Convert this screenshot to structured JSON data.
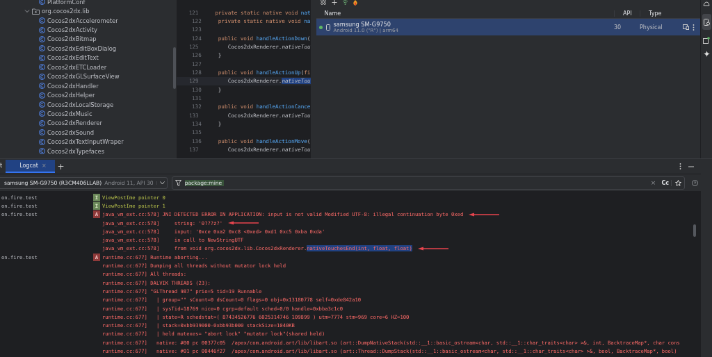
{
  "project_tree": {
    "items": [
      {
        "label": "PlatformConf",
        "kind": "class"
      },
      {
        "label": "org.cocos2dx.lib",
        "kind": "package",
        "expanded": true,
        "children": [
          {
            "label": "Cocos2dxAccelerometer",
            "kind": "class"
          },
          {
            "label": "Cocos2dxActivity",
            "kind": "class"
          },
          {
            "label": "Cocos2dxBitmap",
            "kind": "class"
          },
          {
            "label": "Cocos2dxEditBoxDialog",
            "kind": "class"
          },
          {
            "label": "Cocos2dxEditText",
            "kind": "class"
          },
          {
            "label": "Cocos2dxETCLoader",
            "kind": "class"
          },
          {
            "label": "Cocos2dxGLSurfaceView",
            "kind": "class"
          },
          {
            "label": "Cocos2dxHandler",
            "kind": "class"
          },
          {
            "label": "Cocos2dxHelper",
            "kind": "class"
          },
          {
            "label": "Cocos2dxLocalStorage",
            "kind": "class"
          },
          {
            "label": "Cocos2dxMusic",
            "kind": "class"
          },
          {
            "label": "Cocos2dxRenderer",
            "kind": "class"
          },
          {
            "label": "Cocos2dxSound",
            "kind": "class"
          },
          {
            "label": "Cocos2dxTextInputWraper",
            "kind": "class"
          },
          {
            "label": "Cocos2dxTypefaces",
            "kind": "class"
          }
        ]
      }
    ]
  },
  "editor": {
    "lines": [
      {
        "number": "121",
        "current": false,
        "tokens": [
          {
            "kind": "keyword",
            "text": "private static native void "
          },
          {
            "kind": "method",
            "text": "nat"
          }
        ]
      },
      {
        "number": "122",
        "current": false,
        "tokens": [
          {
            "kind": "keyword",
            "text": "private static native void "
          },
          {
            "kind": "method",
            "text": "na"
          }
        ]
      },
      {
        "number": "123",
        "current": false
      },
      {
        "number": "124",
        "current": false,
        "tokens": [
          {
            "kind": "keyword",
            "text": "public void "
          },
          {
            "kind": "method",
            "text": "handleActionDown"
          },
          {
            "kind": "plain",
            "text": "("
          }
        ]
      },
      {
        "number": "125",
        "current": false,
        "indent": true,
        "tokens": [
          {
            "kind": "plain",
            "text": "Cocos2dxRenderer."
          },
          {
            "kind": "static",
            "text": "nativeTou"
          }
        ]
      },
      {
        "number": "126",
        "current": false,
        "tokens": [
          {
            "kind": "plain",
            "text": "}"
          }
        ]
      },
      {
        "number": "127",
        "current": false
      },
      {
        "number": "128",
        "current": false,
        "tokens": [
          {
            "kind": "keyword",
            "text": "public void "
          },
          {
            "kind": "method",
            "text": "handleActionUp"
          },
          {
            "kind": "plain",
            "text": "("
          },
          {
            "kind": "keyword",
            "text": "fi"
          }
        ]
      },
      {
        "number": "129",
        "current": true,
        "indent": true,
        "tokens": [
          {
            "kind": "plain",
            "text": "Cocos2dxRenderer."
          },
          {
            "kind": "selection",
            "text": "nativeTou"
          }
        ]
      },
      {
        "number": "130",
        "current": false,
        "tokens": [
          {
            "kind": "plain",
            "text": "}"
          }
        ]
      },
      {
        "number": "131",
        "current": false
      },
      {
        "number": "132",
        "current": false,
        "tokens": [
          {
            "kind": "keyword",
            "text": "public void "
          },
          {
            "kind": "method",
            "text": "handleActionCance"
          }
        ]
      },
      {
        "number": "133",
        "current": false,
        "indent": true,
        "tokens": [
          {
            "kind": "plain",
            "text": "Cocos2dxRenderer."
          },
          {
            "kind": "static",
            "text": "nativeTou"
          }
        ]
      },
      {
        "number": "134",
        "current": false,
        "tokens": [
          {
            "kind": "plain",
            "text": "}"
          }
        ]
      },
      {
        "number": "135",
        "current": false
      },
      {
        "number": "136",
        "current": false,
        "tokens": [
          {
            "kind": "keyword",
            "text": "public void "
          },
          {
            "kind": "method",
            "text": "handleActionMove"
          },
          {
            "kind": "plain",
            "text": "("
          }
        ]
      },
      {
        "number": "137",
        "current": false,
        "indent": true,
        "tokens": [
          {
            "kind": "plain",
            "text": "Cocos2dxRenderer."
          },
          {
            "kind": "static",
            "text": "nativeTou"
          }
        ]
      }
    ]
  },
  "device_manager": {
    "columns": [
      "Name",
      "API",
      "Type"
    ],
    "devices": [
      {
        "name": "samsung SM-G9750",
        "details": "Android 11.0 (\"R\") | arm64",
        "api": "30",
        "type": "Physical",
        "selected": true,
        "online": true
      }
    ]
  },
  "logcat": {
    "tabs": [
      {
        "label": "t",
        "selected": false,
        "closable": false
      },
      {
        "label": "Logcat",
        "selected": true,
        "closable": true
      }
    ],
    "add_tab": "+",
    "close_glyph": "×",
    "device_selector": {
      "device": "samsung SM-G9750 (R3CM406LLAB)",
      "details": "Android 11, API 30"
    },
    "filter": {
      "value": "package:mine"
    },
    "case_toggle": "Cc",
    "lines": [
      {
        "tag": "on.fire.test",
        "level": "I",
        "kind": "info",
        "text": "ViewPostIme pointer 0"
      },
      {
        "tag": "on.fire.test",
        "level": "I",
        "kind": "info",
        "text": "ViewPostIme pointer 1"
      },
      {
        "tag": "on.fire.test",
        "level": "A",
        "kind": "assert",
        "text": "java_vm_ext.cc:578] JNI DETECTED ERROR IN APPLICATION: input is not valid Modified UTF-8: illegal continuation byte 0xed",
        "arrow": true
      },
      {
        "kind": "assert",
        "text": "java_vm_ext.cc:578]     string: '0???ż?'",
        "arrow": true
      },
      {
        "kind": "assert",
        "text": "java_vm_ext.cc:578]     input: '0xce 0xa2 0xc8 <0xed> 0xd1 0xc5 0xba 0xda'"
      },
      {
        "kind": "assert",
        "text": "java_vm_ext.cc:578]     in call to NewStringUTF"
      },
      {
        "kind": "assert",
        "text": "java_vm_ext.cc:578]     from void org.cocos2dx.lib.Cocos2dxRenderer.",
        "selection": "nativeTouchesEnd(int, float, float)",
        "arrow": true
      },
      {
        "tag": "on.fire.test",
        "level": "A",
        "kind": "assert",
        "text": "runtime.cc:677] Runtime aborting..."
      },
      {
        "kind": "assert",
        "text": "runtime.cc:677] Dumping all threads without mutator lock held"
      },
      {
        "kind": "assert",
        "text": "runtime.cc:677] All threads:"
      },
      {
        "kind": "assert",
        "text": "runtime.cc:677] DALVIK THREADS (23):"
      },
      {
        "kind": "assert",
        "text": "runtime.cc:677] \"GLThread 987\" prio=5 tid=19 Runnable"
      },
      {
        "kind": "assert",
        "text": "runtime.cc:677]   | group=\"\" sCount=0 dsCount=0 flags=0 obj=0x13180778 self=0xde842a10"
      },
      {
        "kind": "assert",
        "text": "runtime.cc:677]   | sysTid=18769 nice=0 cgrp=default sched=0/0 handle=0xbba3c1c0"
      },
      {
        "kind": "assert",
        "text": "runtime.cc:677]   | state=R schedstat=( 87434526776 6025314746 109899 ) utm=7774 stm=969 core=6 HZ=100"
      },
      {
        "kind": "assert",
        "text": "runtime.cc:677]   | stack=0xbb939000-0xbb93b000 stackSize=1040KB"
      },
      {
        "kind": "assert",
        "text": "runtime.cc:677]   | held mutexes= \"abort lock\" \"mutator lock\"(shared held)"
      },
      {
        "kind": "assert",
        "text": "runtime.cc:677]   native: #00 pc 00377c05  /apex/com.android.art/lib/libart.so (art::DumpNativeStack(std::__1::basic_ostream<char, std::__1::char_traits<char> >&, int, BacktraceMap*, char cons"
      },
      {
        "kind": "assert",
        "text": "runtime.cc:677]   native: #01 pc 00446f27  /apex/com.android.art/lib/libart.so (art::Thread::DumpStack(std::__1::basic_ostream<char, std::__1::char_traits<char> >&, bool, BacktraceMap*, bool)"
      }
    ]
  }
}
